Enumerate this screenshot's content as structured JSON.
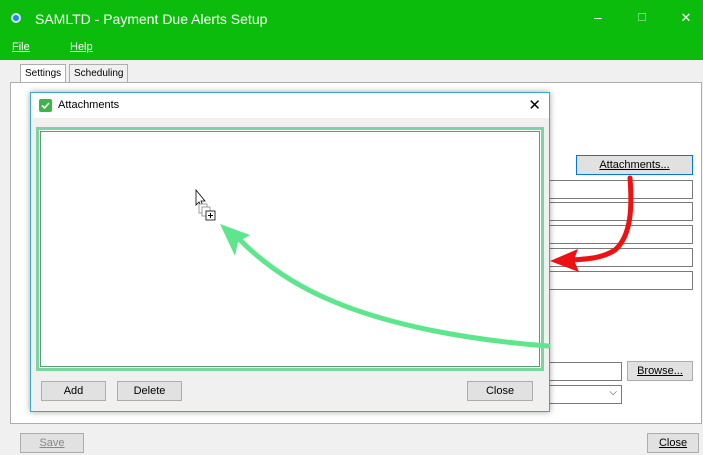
{
  "window": {
    "title": "SAMLTD - Payment Due Alerts Setup",
    "minimize_glyph": "–",
    "maximize_glyph": "☐",
    "close_glyph": "✕"
  },
  "menu": {
    "file": "File",
    "help": "Help"
  },
  "tabs": [
    {
      "label": "Settings",
      "active": true
    },
    {
      "label": "Scheduling",
      "active": false
    }
  ],
  "settings": {
    "attachments_button": "Attachments...",
    "browse_button": "Browse...",
    "combo_arrow": "⌵"
  },
  "footer": {
    "save": "Save",
    "close": "Close"
  },
  "attachments_dialog": {
    "title": "Attachments",
    "close_glyph": "✕",
    "add": "Add",
    "delete": "Delete",
    "close": "Close"
  },
  "annotations": {
    "red_arrow_color": "#ee1111",
    "green_arrow_color": "#5ee68c",
    "cursor_icon": "drag-copy-cursor-icon"
  }
}
